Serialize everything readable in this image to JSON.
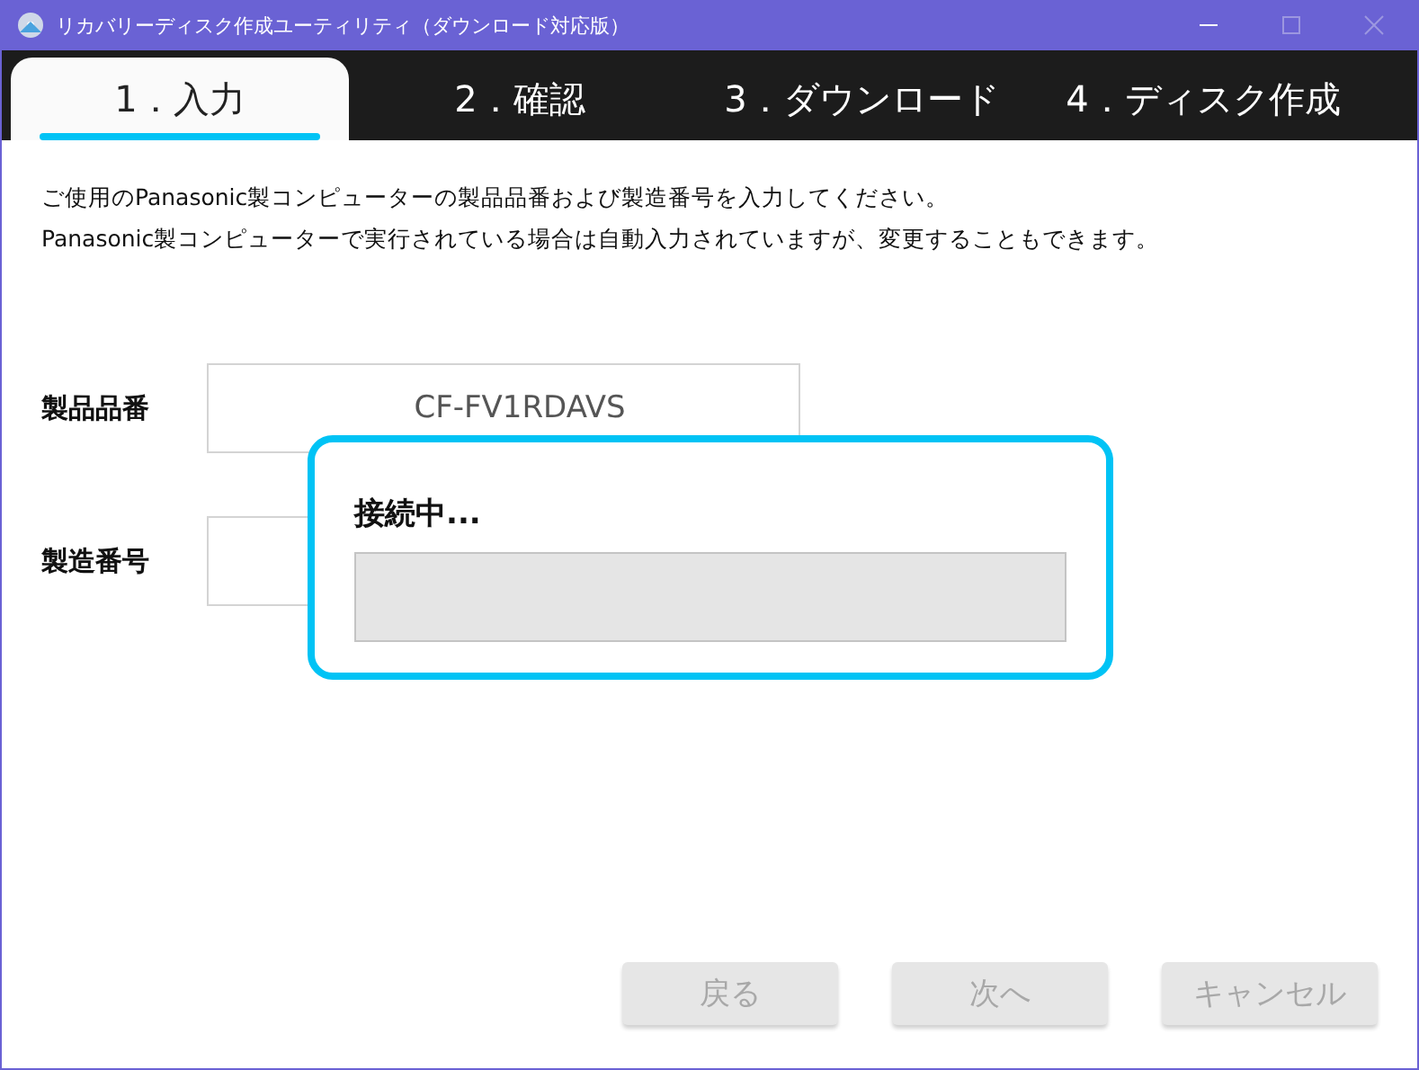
{
  "window": {
    "title": "リカバリーディスク作成ユーティリティ（ダウンロード対応版）"
  },
  "tabs": [
    {
      "label": "1．入力",
      "selected": true
    },
    {
      "label": "2．確認",
      "selected": false
    },
    {
      "label": "3．ダウンロード",
      "selected": false
    },
    {
      "label": "4．ディスク作成",
      "selected": false
    }
  ],
  "instructions": [
    "ご使用のPanasonic製コンピューターの製品品番および製造番号を入力してください。",
    "Panasonic製コンピューターで実行されている場合は自動入力されていますが、変更することもできます。"
  ],
  "fields": [
    {
      "label": "製品品番",
      "value": "CF-FV1RDAVS"
    },
    {
      "label": "製造番号"
    }
  ],
  "dialog": {
    "message": "接続中...",
    "level": 0
  },
  "buttons": [
    {
      "label": "戻る",
      "disabled": true
    },
    {
      "label": "次へ",
      "disabled": true
    },
    {
      "label": "キャンセル",
      "disabled": true
    }
  ]
}
